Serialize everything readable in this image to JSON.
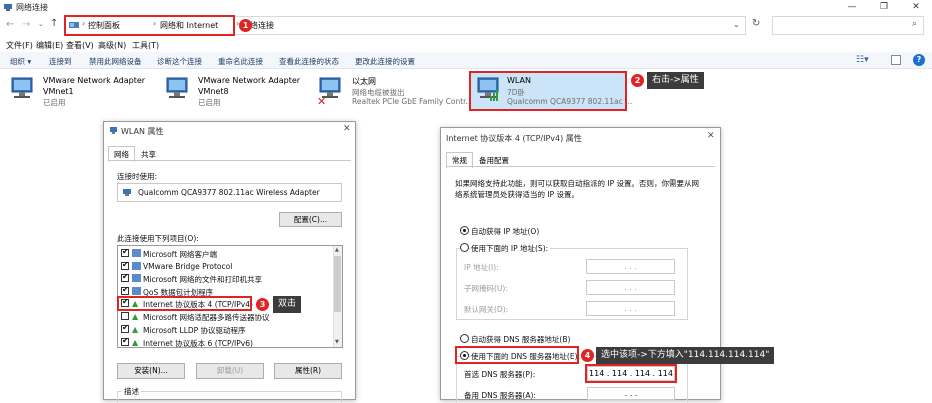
{
  "window": {
    "title": "网络连接",
    "controls": {
      "minimize": "—",
      "maximize": "❐",
      "close": "✕"
    }
  },
  "address": {
    "breadcrumbs": [
      "控制面板",
      "网络和 Internet",
      "网络连接"
    ],
    "search_placeholder": ""
  },
  "menu": [
    "文件(F)",
    "编辑(E)",
    "查看(V)",
    "高级(N)",
    "工具(T)"
  ],
  "toolbar": [
    "组织 ▾",
    "连接到",
    "禁用此网络设备",
    "诊断这个连接",
    "重命名此连接",
    "查看此连接的状态",
    "更改此连接的设置"
  ],
  "adapters": [
    {
      "name": "VMware Network Adapter",
      "line2": "VMnet1",
      "line3": "已启用"
    },
    {
      "name": "VMware Network Adapter",
      "line2": "VMnet8",
      "line3": "已启用"
    },
    {
      "name": "以太网",
      "line2": "网络电缆被拔出",
      "line3": "Realtek PCIe GbE Family Contr..."
    },
    {
      "name": "WLAN",
      "line2": "7D卧",
      "line3": "Qualcomm QCA9377 802.11ac ..."
    }
  ],
  "steps": [
    {
      "num": "1"
    },
    {
      "num": "2",
      "text": "右击->属性"
    },
    {
      "num": "3",
      "text": "双击"
    },
    {
      "num": "4",
      "text": "选中该项->下方填入\"114.114.114.114\""
    }
  ],
  "wlan_dialog": {
    "title": "WLAN 属性",
    "tabs": [
      "网络",
      "共享"
    ],
    "connect_using_label": "连接时使用:",
    "adapter": "Qualcomm QCA9377 802.11ac Wireless Adapter",
    "configure_button": "配置(C)...",
    "items_label": "此连接使用下列项目(O):",
    "items": [
      {
        "label": "Microsoft 网络客户端",
        "checked": true
      },
      {
        "label": "VMware Bridge Protocol",
        "checked": true
      },
      {
        "label": "Microsoft 网络的文件和打印机共享",
        "checked": true
      },
      {
        "label": "QoS 数据包计划程序",
        "checked": true
      },
      {
        "label": "Internet 协议版本 4 (TCP/IPv4)",
        "checked": true
      },
      {
        "label": "Microsoft 网络适配器多路传送器协议",
        "checked": false
      },
      {
        "label": "Microsoft LLDP 协议驱动程序",
        "checked": true
      },
      {
        "label": "Internet 协议版本 6 (TCP/IPv6)",
        "checked": true
      }
    ],
    "install_button": "安装(N)...",
    "uninstall_button": "卸载(U)",
    "properties_button": "属性(R)",
    "description_label": "描述"
  },
  "ipv4_dialog": {
    "title": "Internet 协议版本 4 (TCP/IPv4) 属性",
    "tabs": [
      "常规",
      "备用配置"
    ],
    "intro": [
      "如果网络支持此功能，则可以获取自动指派的 IP 设置。否则，你需要从网",
      "络系统管理员处获得适当的 IP 设置。"
    ],
    "auto_ip": "自动获得 IP 地址(O)",
    "manual_ip": "使用下面的 IP 地址(S):",
    "ip_label": "IP 地址(I):",
    "mask_label": "子网掩码(U):",
    "gateway_label": "默认网关(D):",
    "ip_placeholder": ". . .",
    "auto_dns": "自动获得 DNS 服务器地址(B)",
    "manual_dns": "使用下面的 DNS 服务器地址(E):",
    "preferred_dns_label": "首选 DNS 服务器(P):",
    "preferred_dns_value": "114 . 114 . 114 . 114",
    "alternate_dns_label": "备用 DNS 服务器(A):",
    "alternate_dns_value": ". . ."
  }
}
